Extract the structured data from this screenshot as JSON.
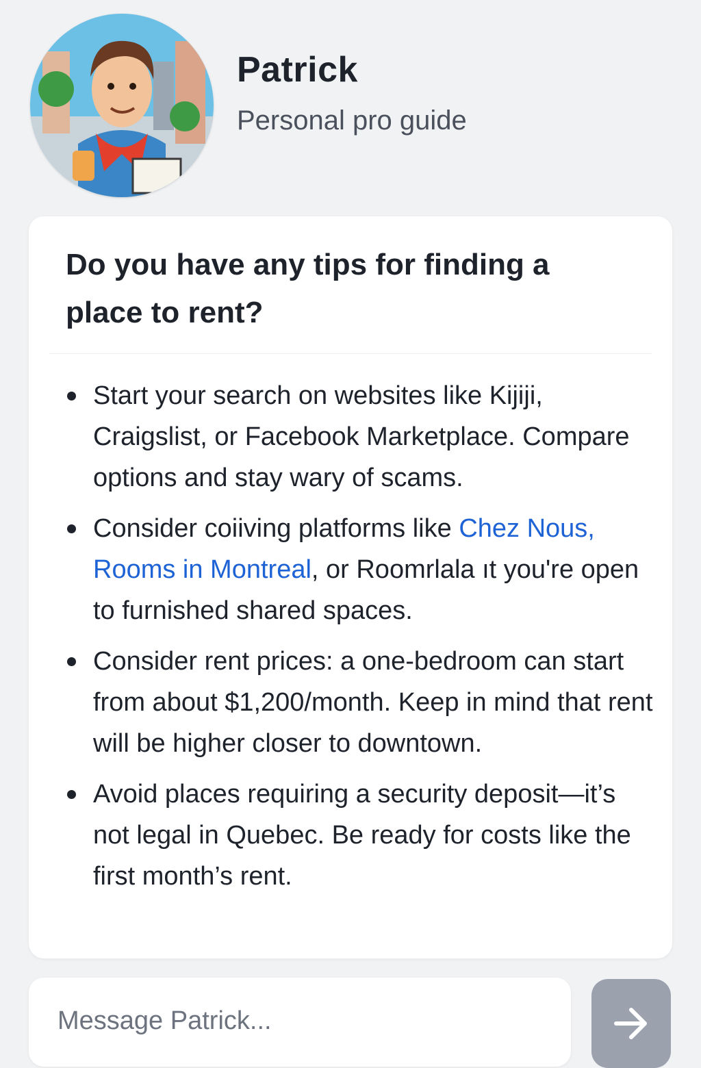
{
  "agent": {
    "name": "Patrick",
    "subtitle": "Personal pro guide",
    "avatar_icon": "illustrated-man-avatar"
  },
  "conversation": {
    "question": "Do you have any tips for finding a place to rent?",
    "tips": [
      {
        "before": "Start your search on websites like Kijiji, Craigslist, or Facebook Marketplace. Compare options and stay wary of scams.",
        "link": "",
        "after": ""
      },
      {
        "before": "Consider coiiving platforms like ",
        "link": "Chez Nous, Rooms in Montreal",
        "after": ", or Roomrlala ıt you're open to furnished shared spaces."
      },
      {
        "before": "Consider rent prices: a one-bedroom can start from about $1,200/month. Keep in mind that rent will be higher closer to downtown.",
        "link": "",
        "after": ""
      },
      {
        "before": "Avoid places requiring a security deposit—it’s not legal in Quebec. Be ready for costs like the first month’s rent.",
        "link": "",
        "after": ""
      }
    ]
  },
  "composer": {
    "placeholder": "Message Patrick...",
    "value": "",
    "send_icon": "arrow-right-icon"
  },
  "colors": {
    "background": "#f1f2f4",
    "card": "#ffffff",
    "link": "#1e63d6",
    "send_button": "#9ba2ae"
  }
}
